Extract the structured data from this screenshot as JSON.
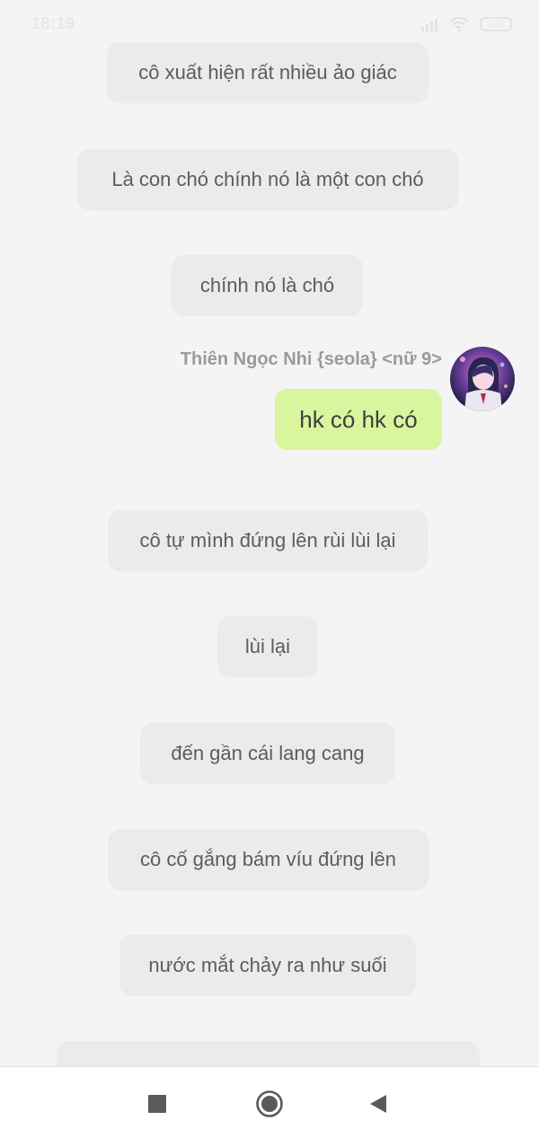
{
  "status_bar": {
    "time": "18:19",
    "battery": "100",
    "icons": [
      "signal-icon",
      "wifi-icon",
      "battery-icon"
    ]
  },
  "messages": [
    {
      "text": "cô xuất hiện rất nhiều ảo giác"
    },
    {
      "text": "Là con chó chính nó là một con chó"
    },
    {
      "text": "chính nó là chó"
    },
    {
      "text": "cô tự mình đứng lên rùi lùi lại"
    },
    {
      "text": "lùi lại"
    },
    {
      "text": "đến gần cái lang cang"
    },
    {
      "text": "cô cố gắng bám víu đứng lên"
    },
    {
      "text": "nước mắt chảy ra như suối"
    },
    {
      "text": "…"
    }
  ],
  "own_message": {
    "sender": "Thiên Ngọc Nhi {seola} <nữ 9>",
    "text": "hk có hk có"
  },
  "nav_bar": {
    "icons": [
      "recents-square-icon",
      "home-circle-icon",
      "back-triangle-icon"
    ]
  },
  "colors": {
    "background": "#f4f4f4",
    "bubble": "#ebebeb",
    "own_bubble": "#d9f59e",
    "text": "#5c5c5c",
    "sender_name": "#9a9a9a"
  }
}
